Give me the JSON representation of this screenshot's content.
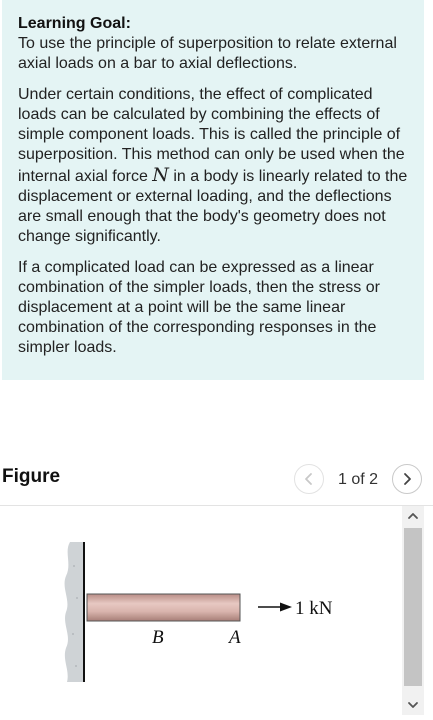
{
  "learning_goal": {
    "title": "Learning Goal:",
    "text": "To use the principle of superposition to relate external axial loads on a bar to axial deflections.",
    "para1_before": "Under certain conditions, the effect of complicated loads can be calculated by combining the effects of simple component loads. This is called the principle of superposition. This method can only be used when the internal axial force ",
    "para1_symbol": "N",
    "para1_after": " in a body is linearly related to the displacement or external loading, and the deflections are small enough that the body's geometry does not change significantly.",
    "para2": "If a complicated load can be expressed as a linear combination of the simpler loads, then the stress or displacement at a point will be the same linear combination of the corresponding responses in the simpler loads."
  },
  "figure": {
    "header": "Figure",
    "page_indicator": "1 of 2",
    "prev_icon": "chevron-left-icon",
    "next_icon": "chevron-right-icon",
    "labels": {
      "force": "1 kN",
      "point_b": "B",
      "point_a": "A"
    }
  },
  "colors": {
    "goal_background": "#e4f4f4",
    "bar_fill": "#d9b4ad",
    "wall": "#cfd3d6"
  }
}
